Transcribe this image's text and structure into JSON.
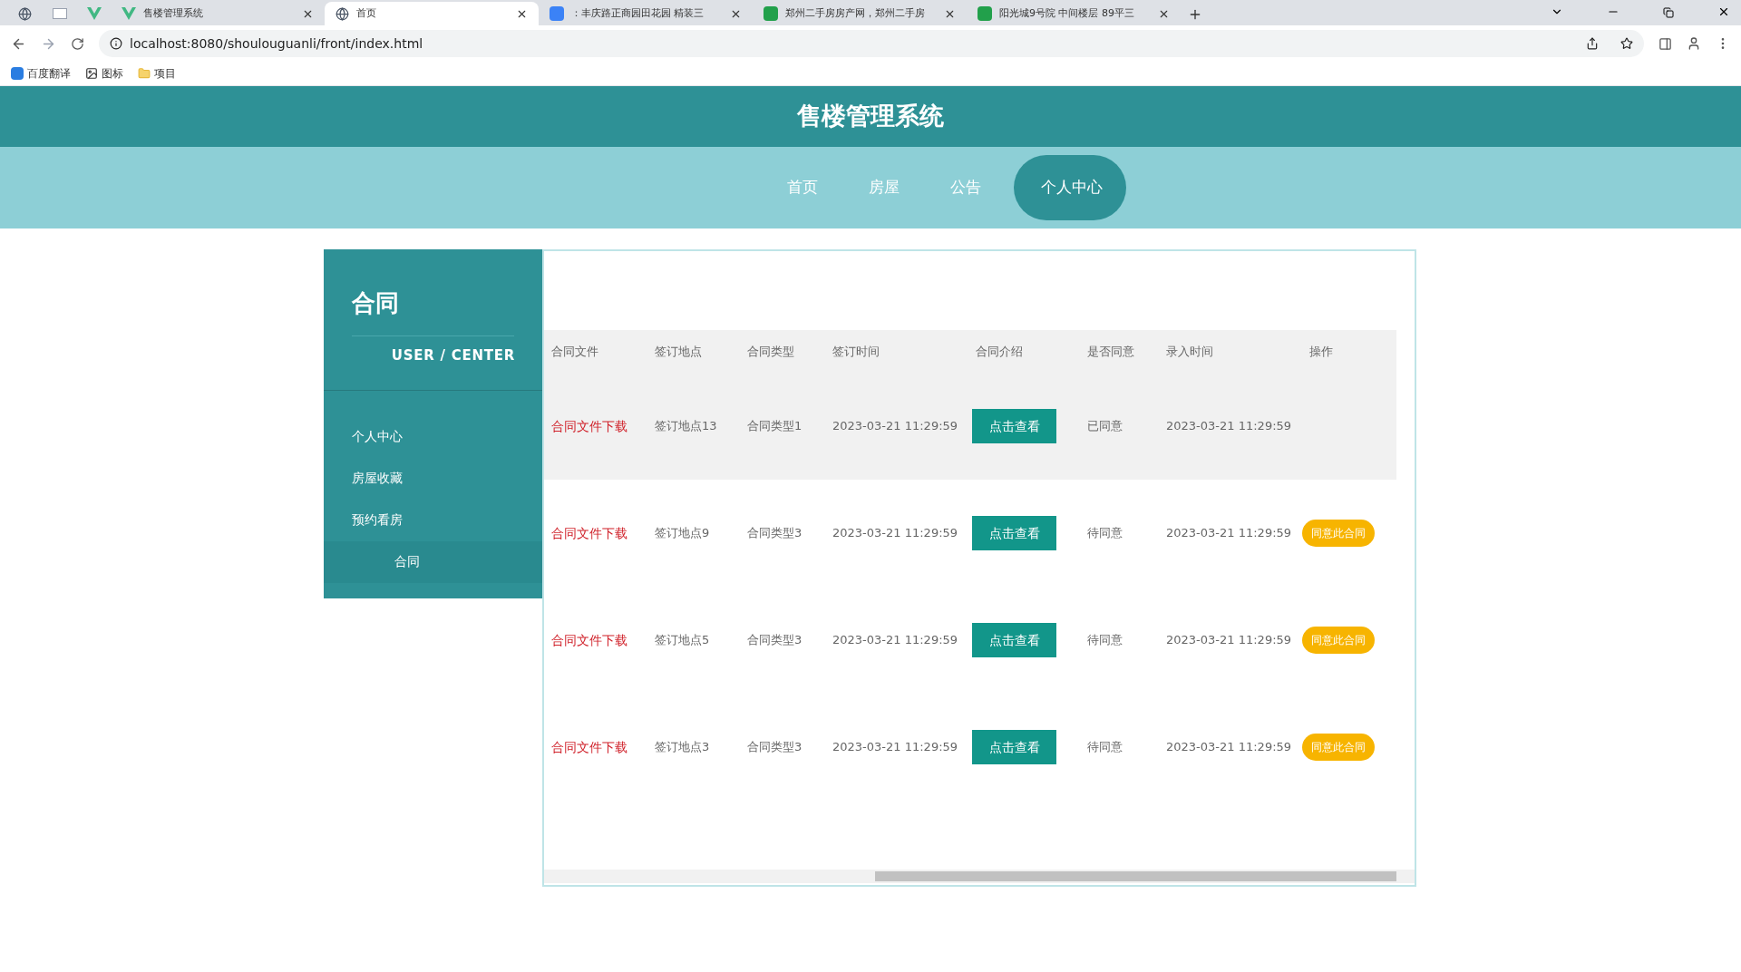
{
  "browser": {
    "tabs": [
      {
        "selected": false
      },
      {
        "selected": false
      },
      {
        "selected": false
      },
      {
        "title": "售楼管理系统",
        "selected": false
      },
      {
        "title": "首页",
        "selected": true
      },
      {
        "title": "：丰庆路正商园田花园 精装三",
        "selected": false
      },
      {
        "title": "郑州二手房房产网，郑州二手房",
        "selected": false
      },
      {
        "title": "阳光城9号院 中间楼层 89平三",
        "selected": false
      }
    ],
    "address": "localhost:8080/shoulouguanli/front/index.html",
    "bookmarks": [
      "百度翻译",
      "图标",
      "项目"
    ]
  },
  "site_title": "售楼管理系统",
  "nav": [
    {
      "label": "首页",
      "selected": false
    },
    {
      "label": "房屋",
      "selected": false
    },
    {
      "label": "公告",
      "selected": false
    },
    {
      "label": "个人中心",
      "selected": true
    }
  ],
  "sidebar": {
    "title": "合同",
    "subtitle": "USER / CENTER",
    "items": [
      {
        "label": "个人中心",
        "selected": false
      },
      {
        "label": "房屋收藏",
        "selected": false
      },
      {
        "label": "预约看房",
        "selected": false
      },
      {
        "label": "合同",
        "selected": true
      }
    ]
  },
  "table": {
    "columns": [
      "合同文件",
      "签订地点",
      "合同类型",
      "签订时间",
      "合同介绍",
      "是否同意",
      "录入时间",
      "操作"
    ],
    "rows": [
      {
        "file": "合同文件下载",
        "place": "签订地点13",
        "type": "合同类型1",
        "signed": "2023-03-21 11:29:59",
        "intro": "点击查看",
        "agreed": "已同意",
        "entered": "2023-03-21 11:29:59",
        "highlighted": true
      },
      {
        "file": "合同文件下载",
        "place": "签订地点9",
        "type": "合同类型3",
        "signed": "2023-03-21 11:29:59",
        "intro": "点击查看",
        "agreed": "待同意",
        "entered": "2023-03-21 11:29:59",
        "action": "同意此合同",
        "highlighted": false
      },
      {
        "file": "合同文件下载",
        "place": "签订地点5",
        "type": "合同类型3",
        "signed": "2023-03-21 11:29:59",
        "intro": "点击查看",
        "agreed": "待同意",
        "entered": "2023-03-21 11:29:59",
        "action": "同意此合同",
        "highlighted": false
      },
      {
        "file": "合同文件下载",
        "place": "签订地点3",
        "type": "合同类型3",
        "signed": "2023-03-21 11:29:59",
        "intro": "点击查看",
        "agreed": "待同意",
        "entered": "2023-03-21 11:29:59",
        "action": "同意此合同",
        "highlighted": false
      }
    ]
  }
}
